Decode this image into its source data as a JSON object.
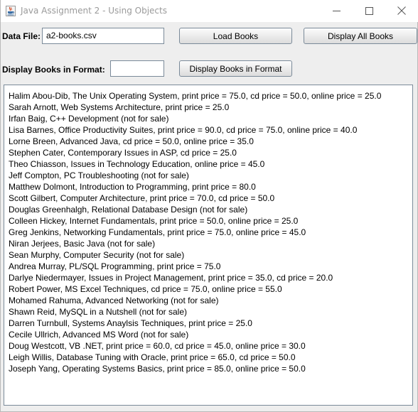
{
  "window": {
    "title": "Java Assignment 2 - Using Objects"
  },
  "form": {
    "data_file_label": "Data File:",
    "data_file_value": "a2-books.csv",
    "load_button": "Load Books",
    "display_all_button": "Display All Books",
    "format_label": "Display Books in Format:",
    "format_value": "",
    "display_format_button": "Display Books in Format"
  },
  "output": {
    "lines": [
      "Halim Abou-Dib, The Unix Operating System, print price = 75.0, cd price = 50.0, online price = 25.0",
      "Sarah Arnott, Web Systems Architecture, print price = 25.0",
      "Irfan Baig, C++ Development (not for sale)",
      "Lisa Barnes, Office Productivity Suites, print price = 90.0, cd price = 75.0, online price = 40.0",
      "Lorne Breen, Advanced Java, cd price = 50.0, online price = 35.0",
      "Stephen Cater, Contemporary Issues in ASP, cd price = 25.0",
      "Theo Chiasson, Issues in Technology Education, online price = 45.0",
      "Jeff Compton, PC Troubleshooting (not for sale)",
      "Matthew Dolmont, Introduction to Programming, print price = 80.0",
      "Scott Gilbert, Computer Architecture, print price = 70.0, cd price = 50.0",
      "Douglas Greenhalgh, Relational Database Design (not for sale)",
      "Colleen Hickey, Internet Fundamentals, print price = 50.0, online price = 25.0",
      "Greg Jenkins, Networking Fundamentals, print price = 75.0, online price = 45.0",
      "Niran Jerjees, Basic Java (not for sale)",
      "Sean Murphy, Computer Security (not for sale)",
      "Andrea Murray, PL/SQL Programming, print price = 75.0",
      "Darlye Niedermayer, Issues in Project Management, print price = 35.0, cd price = 20.0",
      "Robert Power, MS Excel Techniques, cd price = 75.0, online price = 55.0",
      "Mohamed Rahuma, Advanced Networking (not for sale)",
      "Shawn Reid, MySQL in a Nutshell (not for sale)",
      "Darren Turnbull, Systems Anaylsis Techniques, print price = 25.0",
      "Cecile Ullrich, Advanced MS Word (not for sale)",
      "Doug Westcott, VB .NET, print price = 60.0, cd price = 45.0, online price = 30.0",
      "Leigh Willis, Database Tuning with Oracle, print price = 65.0, cd price = 50.0",
      "Joseph Yang, Operating Systems Basics, print price = 85.0, online price = 50.0"
    ]
  },
  "icons": {
    "app": "java-coffee-cup-icon",
    "minimize": "minimize-icon",
    "maximize": "maximize-icon",
    "close": "close-icon"
  },
  "colors": {
    "window_bg": "#eeeeee",
    "border": "#7a8a99",
    "title_text": "#9a9a9a"
  }
}
